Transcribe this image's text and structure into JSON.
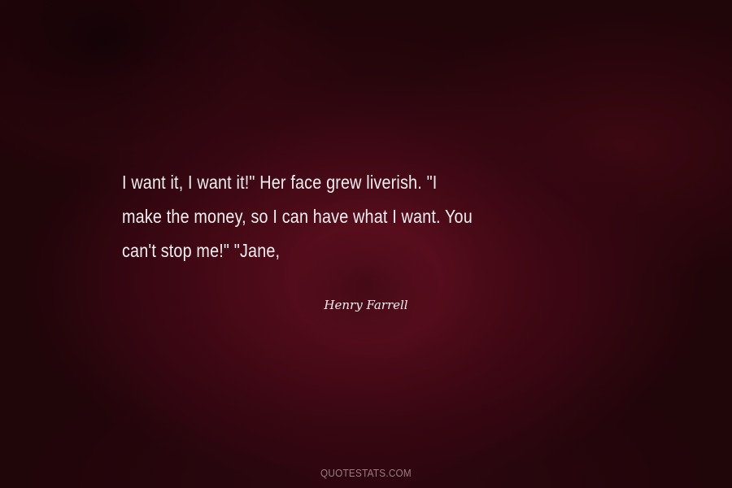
{
  "quote": {
    "lines": [
      "I want it, I want it!\" Her face grew liverish. \"I",
      "make the money, so I can have what I want. You",
      "can't stop me!\" \"Jane,"
    ]
  },
  "author": "Henry Farrell",
  "watermark": "QUOTESTATS.COM",
  "colors": {
    "background": "#3a0711",
    "text": "#f4eef0",
    "watermark": "#a07a80"
  }
}
